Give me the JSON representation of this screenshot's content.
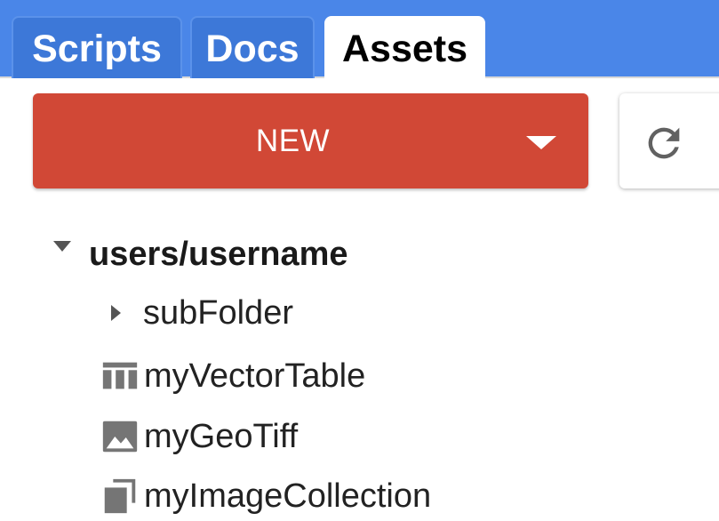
{
  "tabs": [
    {
      "label": "Scripts",
      "active": false
    },
    {
      "label": "Docs",
      "active": false
    },
    {
      "label": "Assets",
      "active": true
    }
  ],
  "toolbar": {
    "new_label": "NEW",
    "new_icon": "chevron-down-icon",
    "refresh_icon": "refresh-icon"
  },
  "tree": {
    "root": {
      "label": "users/username",
      "expanded": true,
      "icon": "triangle-down-icon"
    },
    "items": [
      {
        "label": "subFolder",
        "type": "folder",
        "icon": "triangle-right-icon"
      },
      {
        "label": "myVectorTable",
        "type": "table",
        "icon": "table-icon"
      },
      {
        "label": "myGeoTiff",
        "type": "image",
        "icon": "image-icon"
      },
      {
        "label": "myImageCollection",
        "type": "image-collection",
        "icon": "image-collection-icon"
      }
    ]
  },
  "colors": {
    "tab_bar": "#4a86e8",
    "new_button": "#d14836",
    "icon_gray": "#757575"
  }
}
